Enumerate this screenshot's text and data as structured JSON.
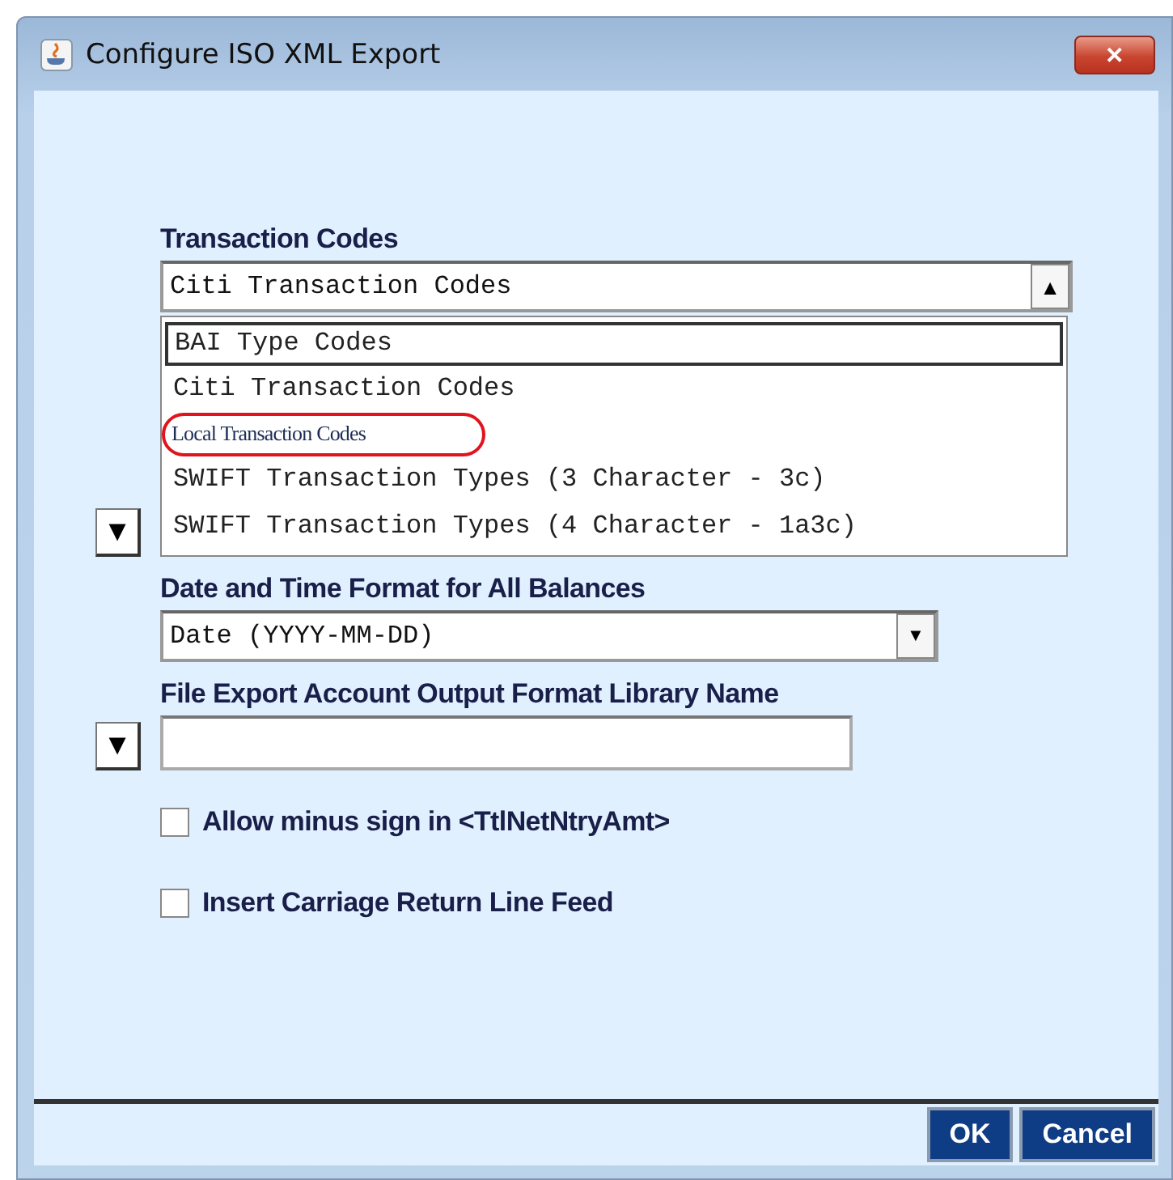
{
  "window": {
    "title": "Configure ISO XML Export",
    "close": "✕"
  },
  "transaction_codes": {
    "label": "Transaction Codes",
    "value": "Citi Transaction Codes",
    "arrow": "▲",
    "expanded": true,
    "toggle": "▼",
    "options": [
      {
        "label": "BAI Type Codes",
        "highlighted": true,
        "circled": false
      },
      {
        "label": "Citi Transaction Codes",
        "highlighted": false,
        "circled": false
      },
      {
        "label": "Local Transaction Codes",
        "highlighted": false,
        "circled": true
      },
      {
        "label": "SWIFT Transaction Types (3 Character - 3c)",
        "highlighted": false,
        "circled": false
      },
      {
        "label": "SWIFT Transaction Types (4 Character - 1a3c)",
        "highlighted": false,
        "circled": false
      }
    ]
  },
  "date_format": {
    "label": "Date and Time Format for All Balances",
    "value": "Date (YYYY-MM-DD)",
    "arrow": "▼"
  },
  "library_name": {
    "label": "File Export Account Output Format Library Name",
    "toggle": "▼"
  },
  "checkboxes": [
    {
      "label": "Allow minus sign in <TtlNetNtryAmt>",
      "checked": false
    },
    {
      "label": "Insert Carriage Return Line Feed",
      "checked": false
    }
  ],
  "buttons": [
    "OK",
    "Cancel"
  ]
}
